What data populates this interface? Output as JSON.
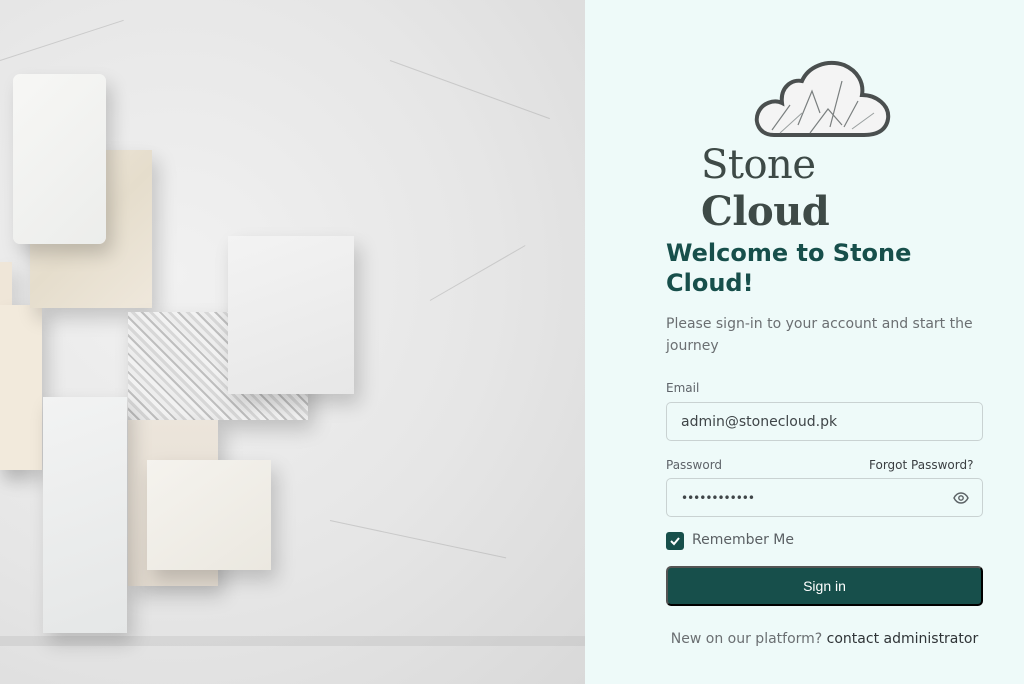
{
  "branding": {
    "name_first": "Stone",
    "name_second": "Cloud"
  },
  "icons": {
    "logo": "marble-cloud-logo",
    "password_toggle": "eye-icon",
    "checkbox": "checkmark-icon"
  },
  "colors": {
    "primary": "#174f4b",
    "panel_bg": "#eefaf9",
    "button_text": "#ffffff"
  },
  "login": {
    "title": "Welcome to Stone Cloud!",
    "subtitle": "Please sign-in to your account and start the journey",
    "email": {
      "label": "Email",
      "value": "admin@stonecloud.pk"
    },
    "password": {
      "label": "Password",
      "masked_value": "••••••••••••",
      "forgot_link": "Forgot Password?"
    },
    "remember_me": {
      "label": "Remember Me",
      "checked": true
    },
    "submit_label": "Sign in",
    "footer": {
      "prefix": "New on our platform?",
      "link_text": "contact administrator"
    }
  }
}
